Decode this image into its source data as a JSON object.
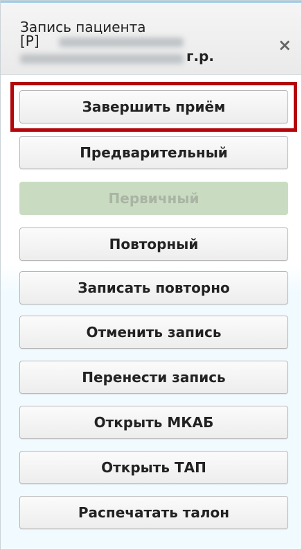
{
  "header": {
    "title": "Запись пациента",
    "patient_id_prefix": "[Р]",
    "dob_suffix": "г.р.",
    "close_symbol": "×"
  },
  "buttons": [
    {
      "label": "Завершить приём",
      "enabled": true,
      "highlighted": true
    },
    {
      "label": "Предварительный",
      "enabled": true
    },
    {
      "label": "Первичный",
      "enabled": false
    },
    {
      "label": "Повторный",
      "enabled": true
    },
    {
      "label": "Записать повторно",
      "enabled": true
    },
    {
      "label": "Отменить запись",
      "enabled": true
    },
    {
      "label": "Перенести запись",
      "enabled": true
    },
    {
      "label": "Открыть МКАБ",
      "enabled": true
    },
    {
      "label": "Открыть ТАП",
      "enabled": true
    },
    {
      "label": "Распечатать талон",
      "enabled": true
    }
  ],
  "colors": {
    "highlight_border": "#b4070c",
    "disabled_button_bg": "#c9dcc2",
    "disabled_button_text": "#a9b4a3"
  }
}
